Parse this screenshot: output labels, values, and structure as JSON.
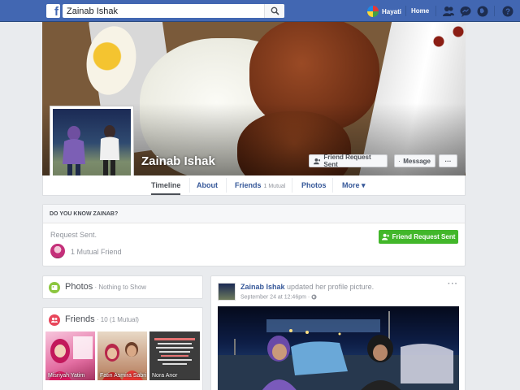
{
  "topbar": {
    "search_value": "Zainab Ishak",
    "user_name": "Hayati",
    "home_label": "Home"
  },
  "profile": {
    "name": "Zainab Ishak",
    "buttons": {
      "friend_request": "Friend Request Sent",
      "message": "Message",
      "more": "···"
    }
  },
  "tabs": [
    {
      "label": "Timeline",
      "sub": ""
    },
    {
      "label": "About",
      "sub": ""
    },
    {
      "label": "Friends",
      "sub": "1 Mutual"
    },
    {
      "label": "Photos",
      "sub": ""
    },
    {
      "label": "More ▾",
      "sub": ""
    }
  ],
  "know_box": {
    "header": "DO YOU KNOW ZAINAB?",
    "status": "Request Sent.",
    "mutual": "1 Mutual Friend",
    "button": "Friend Request Sent"
  },
  "photos_card": {
    "title": "Photos",
    "subtitle": " · Nothing to Show"
  },
  "friends_card": {
    "title": "Friends",
    "subtitle": " · 10 (1 Mutual)",
    "tiles": [
      {
        "name": "Misriyah Yatim"
      },
      {
        "name": "Fatin Asmira Sabri"
      },
      {
        "name": "Nora Anor"
      }
    ]
  },
  "post": {
    "author": "Zainab Ishak",
    "action": " updated her profile picture.",
    "time": "September 24 at 12:46pm · ",
    "more": "···"
  },
  "colors": {
    "brand": "#4267b2",
    "link": "#365899",
    "green": "#42b72a",
    "background": "#e9ebee"
  }
}
